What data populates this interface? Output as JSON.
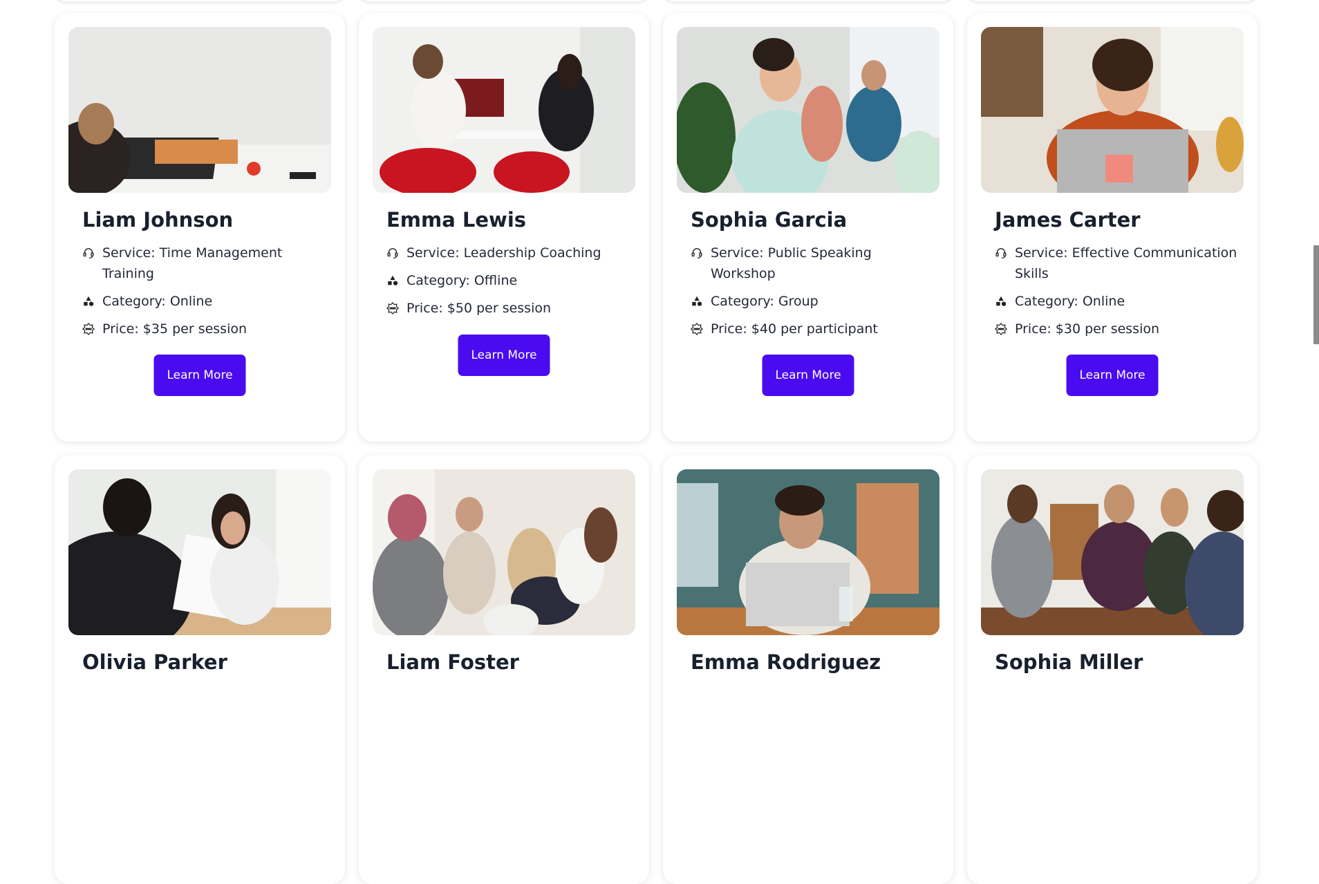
{
  "cards": [
    {
      "name": "Liam Johnson",
      "service": "Service: Time Management Training",
      "category": "Category: Online",
      "price": "Price: $35 per session",
      "button": "Learn More"
    },
    {
      "name": "Emma Lewis",
      "service": "Service: Leadership Coaching",
      "category": "Category: Offline",
      "price": "Price: $50 per session",
      "button": "Learn More"
    },
    {
      "name": "Sophia Garcia",
      "service": "Service: Public Speaking Workshop",
      "category": "Category: Group",
      "price": "Price: $40 per participant",
      "button": "Learn More"
    },
    {
      "name": "James Carter",
      "service": "Service: Effective Communication Skills",
      "category": "Category: Online",
      "price": "Price: $30 per session",
      "button": "Learn More"
    },
    {
      "name": "Olivia Parker"
    },
    {
      "name": "Liam Foster"
    },
    {
      "name": "Emma Rodriguez"
    },
    {
      "name": "Sophia Miller"
    }
  ],
  "colors": {
    "accent": "#4a0bf0",
    "text": "#18202e"
  },
  "icons": {
    "service": "headset-icon",
    "category": "shapes-icon",
    "price": "price-badge-icon"
  }
}
